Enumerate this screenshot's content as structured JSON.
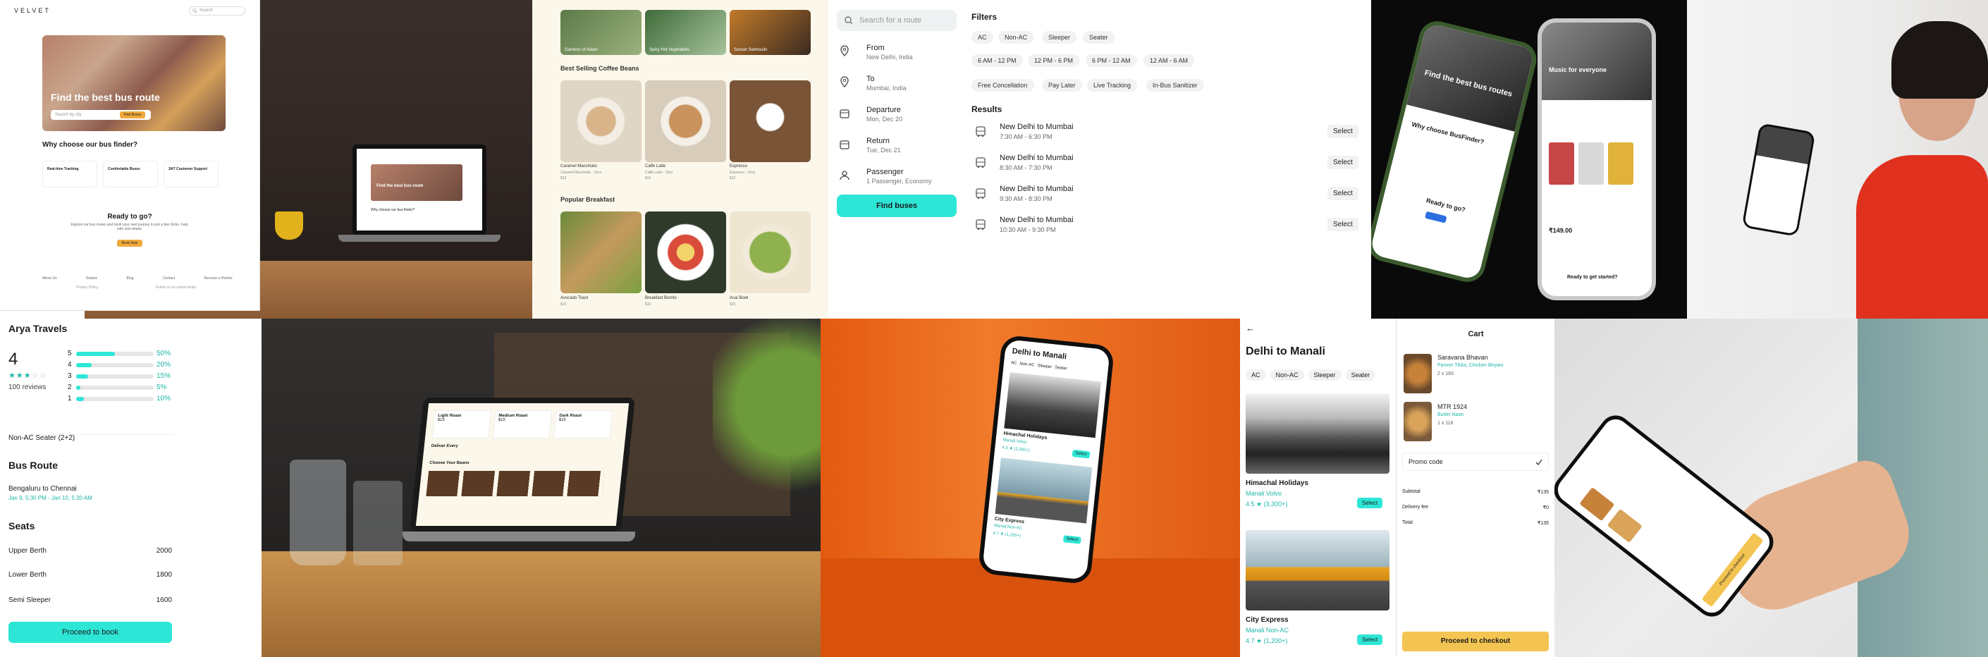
{
  "landing": {
    "brand": "VELVET",
    "search_placeholder": "Search",
    "hero_title": "Find the best bus route",
    "hero_input": "Search by city",
    "hero_button": "Find Buses",
    "why_title": "Why choose our bus finder?",
    "features": [
      "Real-time Tracking",
      "Comfortable Buses",
      "24/7 Customer Support"
    ],
    "ready_title": "Ready to go?",
    "ready_text": "Explore our bus routes and book your next journey in just a few clicks. Fast, safe and simple.",
    "ready_button": "Book Now",
    "footer_links": [
      "About Us",
      "Routes",
      "Blog",
      "Contact",
      "Become a Partner"
    ],
    "footer_bottom": [
      "Privacy Policy",
      "Follow us on social media"
    ]
  },
  "laptop_screen": {
    "title": "Find the best bus route",
    "why": "Why choose our bus finder?"
  },
  "menu": {
    "top_tiles": [
      "Gardens of Adam",
      "Spicy Hot Vegetables",
      "Sunset Swimsuits"
    ],
    "section1": "Best Selling Coffee Beans",
    "coffees": [
      {
        "name": "Caramel Macchiato",
        "sub": "Caramel Macchiato - 15oz",
        "price": "$12"
      },
      {
        "name": "Caffe Latte",
        "sub": "Caffe Latte - 15oz",
        "price": "$12"
      },
      {
        "name": "Espresso",
        "sub": "Espresso - 15oz",
        "price": "$12"
      }
    ],
    "section2": "Popular Breakfast",
    "breakfast": [
      {
        "name": "Avocado Toast",
        "price": "$15"
      },
      {
        "name": "Breakfast Burrito",
        "price": "$15"
      },
      {
        "name": "Acai Bowl",
        "price": "$15"
      }
    ]
  },
  "search": {
    "placeholder": "Search for a route",
    "fields": [
      {
        "label": "From",
        "value": "New Delhi, India",
        "icon": "location-pin-icon"
      },
      {
        "label": "To",
        "value": "Mumbai, India",
        "icon": "location-pin-icon"
      },
      {
        "label": "Departure",
        "value": "Mon, Dec 20",
        "icon": "calendar-icon"
      },
      {
        "label": "Return",
        "value": "Tue, Dec 21",
        "icon": "calendar-icon"
      },
      {
        "label": "Passenger",
        "value": "1 Passenger, Economy",
        "icon": "person-icon"
      }
    ],
    "button": "Find buses"
  },
  "filters": {
    "title": "Filters",
    "row1": [
      "AC",
      "Non-AC",
      "Sleeper",
      "Seater"
    ],
    "row2": [
      "6 AM - 12 PM",
      "12 PM - 6 PM",
      "6 PM - 12 AM",
      "12 AM - 6 AM"
    ],
    "row3": [
      "Free Concellation",
      "Pay Later",
      "Live Tracking",
      "In-Bus Sanitizer"
    ],
    "results_title": "Results",
    "results": [
      {
        "route": "New Delhi to Mumbai",
        "time": "7:30 AM - 6:30 PM",
        "action": "Select"
      },
      {
        "route": "New Delhi to Mumbai",
        "time": "8:30 AM - 7:30 PM",
        "action": "Select"
      },
      {
        "route": "New Delhi to Mumbai",
        "time": "9:30 AM - 8:30 PM",
        "action": "Select"
      },
      {
        "route": "New Delhi to Mumbai",
        "time": "10:30 AM - 9:30 PM",
        "action": "Select"
      }
    ]
  },
  "phones": {
    "left_title": "Find the best bus routes",
    "left_why": "Why choose BusFinder?",
    "left_ready": "Ready to go?",
    "right_title": "Music for everyone",
    "right_price": "₹149.00",
    "right_cta": "Ready to get started?"
  },
  "rating": {
    "company": "Arya Travels",
    "score": "4",
    "reviews": "100 reviews",
    "bars": [
      {
        "star": "5",
        "pct": "50%",
        "fraction": 0.5
      },
      {
        "star": "4",
        "pct": "20%",
        "fraction": 0.2
      },
      {
        "star": "3",
        "pct": "15%",
        "fraction": 0.15
      },
      {
        "star": "2",
        "pct": "5%",
        "fraction": 0.05
      },
      {
        "star": "1",
        "pct": "10%",
        "fraction": 0.1
      }
    ],
    "stars_filled": 3,
    "bus_type": "Non-AC Seater (2+2)",
    "route_title": "Bus Route",
    "route": "Bengaluru to Chennai",
    "route_time": "Jan 9, 5:30 PM - Jan 10, 5:30 AM",
    "seats_title": "Seats",
    "seats": [
      {
        "name": "Upper Berth",
        "price": "2000"
      },
      {
        "name": "Lower Berth",
        "price": "1800"
      },
      {
        "name": "Semi Sleeper",
        "price": "1600"
      }
    ],
    "button": "Proceed to book",
    "accent": "#2ee6d6"
  },
  "cafe_laptop": {
    "plans": [
      {
        "name": "Light Roast",
        "price": "$15"
      },
      {
        "name": "Medium Roast",
        "price": "$15"
      },
      {
        "name": "Dark Roast",
        "price": "$15"
      }
    ],
    "delivery": "Deliver Every",
    "choose": "Choose Your Beans"
  },
  "orange_phone": {
    "title": "Delhi to Manali",
    "chips": [
      "AC",
      "Non-AC",
      "Sleeper",
      "Seater"
    ],
    "cards": [
      {
        "name": "Himachal Holidays",
        "sub": "Manali Volvo",
        "rating": "4.5 ★ (3,300+)",
        "action": "Select"
      },
      {
        "name": "City Express",
        "sub": "Manali Non-AC",
        "rating": "4.7 ★ (1,200+)",
        "action": "Select"
      }
    ]
  },
  "manali": {
    "back": "←",
    "title": "Delhi to Manali",
    "chips": [
      "AC",
      "Non-AC",
      "Sleeper",
      "Seater"
    ],
    "cards": [
      {
        "name": "Himachal Holidays",
        "sub": "Manali Volvo",
        "rating": "4.5 ★ (3,300+)",
        "action": "Select"
      },
      {
        "name": "City Express",
        "sub": "Manali Non-AC",
        "rating": "4.7 ★ (1,200+)",
        "action": "Select"
      }
    ]
  },
  "cart": {
    "title": "Cart",
    "items": [
      {
        "name": "Saravana Bhavan",
        "desc": "Paneer Tikka, Chicken Biryani",
        "qty": "2 x 160"
      },
      {
        "name": "MTR 1924",
        "desc": "Butter Naan",
        "qty": "1 x 118"
      }
    ],
    "promo": "Promo code",
    "lines": [
      {
        "label": "Subtotal",
        "value": "₹135"
      },
      {
        "label": "Delivery fee",
        "value": "₹0"
      },
      {
        "label": "Total",
        "value": "₹135"
      }
    ],
    "button": "Proceed to checkout"
  },
  "hand_phone": {
    "button": "Proceed to checkout"
  }
}
